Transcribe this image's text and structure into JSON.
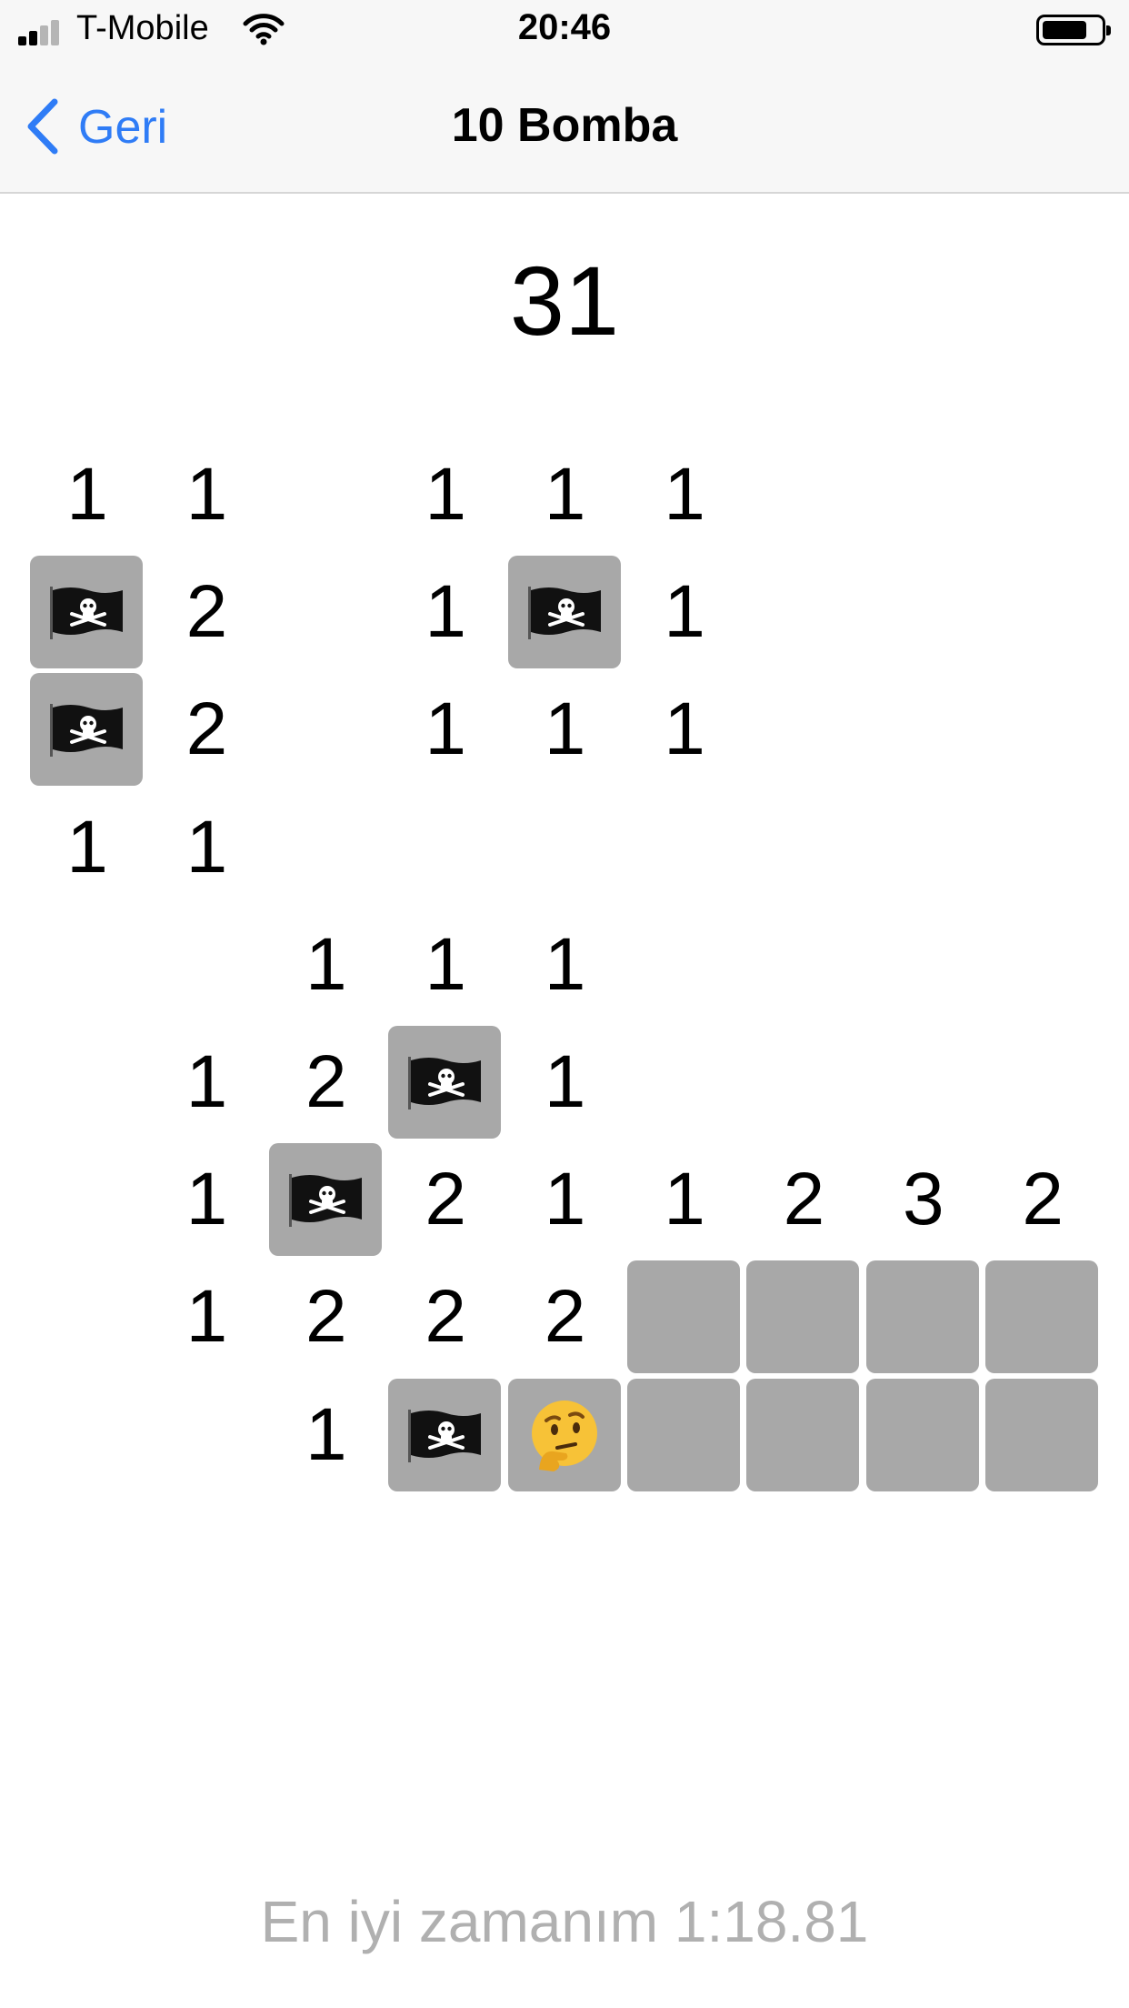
{
  "status_bar": {
    "carrier": "T-Mobile",
    "time": "20:46",
    "signal_bars": 2,
    "battery_level": 0.75
  },
  "nav": {
    "back_label": "Geri",
    "title": "10 Bomba"
  },
  "counter": "31",
  "board": {
    "columns": 9,
    "rows": 9,
    "cells": [
      [
        "1",
        "1",
        "",
        "1",
        "1",
        "1",
        "",
        "",
        ""
      ],
      [
        "F",
        "2",
        "",
        "1",
        "F",
        "1",
        "",
        "",
        ""
      ],
      [
        "F",
        "2",
        "",
        "1",
        "1",
        "1",
        "",
        "",
        ""
      ],
      [
        "1",
        "1",
        "",
        "",
        "",
        "",
        "",
        "",
        ""
      ],
      [
        "",
        "",
        "1",
        "1",
        "1",
        "",
        "",
        "",
        ""
      ],
      [
        "",
        "1",
        "2",
        "F",
        "1",
        "",
        "",
        "",
        ""
      ],
      [
        "",
        "1",
        "F",
        "2",
        "1",
        "1",
        "2",
        "3",
        "2"
      ],
      [
        "",
        "1",
        "2",
        "2",
        "2",
        "C",
        "C",
        "C",
        "C"
      ],
      [
        "",
        "",
        "1",
        "F",
        "T",
        "C",
        "C",
        "C",
        "C"
      ]
    ],
    "legend": {
      "F": "flag-icon",
      "T": "thinking-face-icon",
      "C": "covered"
    }
  },
  "best_time": "En iyi zamanım 1:18.81",
  "colors": {
    "accent": "#2f7cf6",
    "covered_cell": "#a8a8a8",
    "bar_background": "#f7f7f7",
    "best_time_text": "#b0b0b0"
  }
}
